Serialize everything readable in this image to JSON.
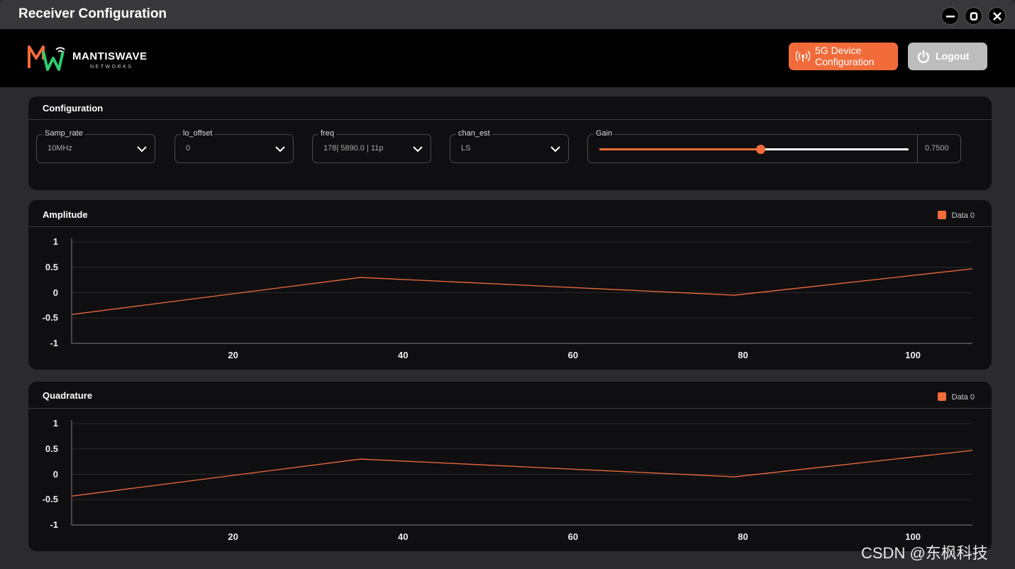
{
  "window": {
    "title": "Receiver Configuration"
  },
  "header": {
    "logo_text": "MANTISWAVE",
    "logo_sub": "NETWORKS",
    "device_button": "5G Device Configuration",
    "logout_button": "Logout"
  },
  "config": {
    "title": "Configuration",
    "fields": [
      {
        "label": "Samp_rate",
        "value": "10MHz"
      },
      {
        "label": "lo_offset",
        "value": "0"
      },
      {
        "label": "freq",
        "value": "178| 5890.0 | 11p"
      },
      {
        "label": "chan_est",
        "value": "LS"
      }
    ],
    "gain": {
      "label": "Gain",
      "value_text": "0.7500",
      "slider_fraction": 0.52
    }
  },
  "colors": {
    "accent": "#f26b3a",
    "panel": "#0f0f11",
    "bg": "#2b2b2d"
  },
  "chart_data": [
    {
      "type": "line",
      "title": "Amplitude",
      "x": [
        1,
        35,
        79,
        107
      ],
      "series": [
        {
          "name": "Data 0",
          "values": [
            -0.43,
            0.3,
            -0.05,
            0.47
          ]
        }
      ],
      "xticks": [
        "20",
        "40",
        "60",
        "80",
        "100"
      ],
      "xtick_values": [
        20,
        40,
        60,
        80,
        100
      ],
      "yticks": [
        "1",
        "0.5",
        "0",
        "-0.5",
        "-1"
      ],
      "ytick_values": [
        1,
        0.5,
        0,
        -0.5,
        -1
      ],
      "xlim": [
        1,
        107
      ],
      "ylim": [
        -1,
        1
      ],
      "legend": "top-right"
    },
    {
      "type": "line",
      "title": "Quadrature",
      "x": [
        1,
        35,
        79,
        107
      ],
      "series": [
        {
          "name": "Data 0",
          "values": [
            -0.43,
            0.3,
            -0.05,
            0.47
          ]
        }
      ],
      "xticks": [
        "20",
        "40",
        "60",
        "80",
        "100"
      ],
      "xtick_values": [
        20,
        40,
        60,
        80,
        100
      ],
      "yticks": [
        "1",
        "0.5",
        "0",
        "-0.5",
        "-1"
      ],
      "ytick_values": [
        1,
        0.5,
        0,
        -0.5,
        -1
      ],
      "xlim": [
        1,
        107
      ],
      "ylim": [
        -1,
        1
      ],
      "legend": "top-right"
    }
  ],
  "watermark": "CSDN @东枫科技"
}
